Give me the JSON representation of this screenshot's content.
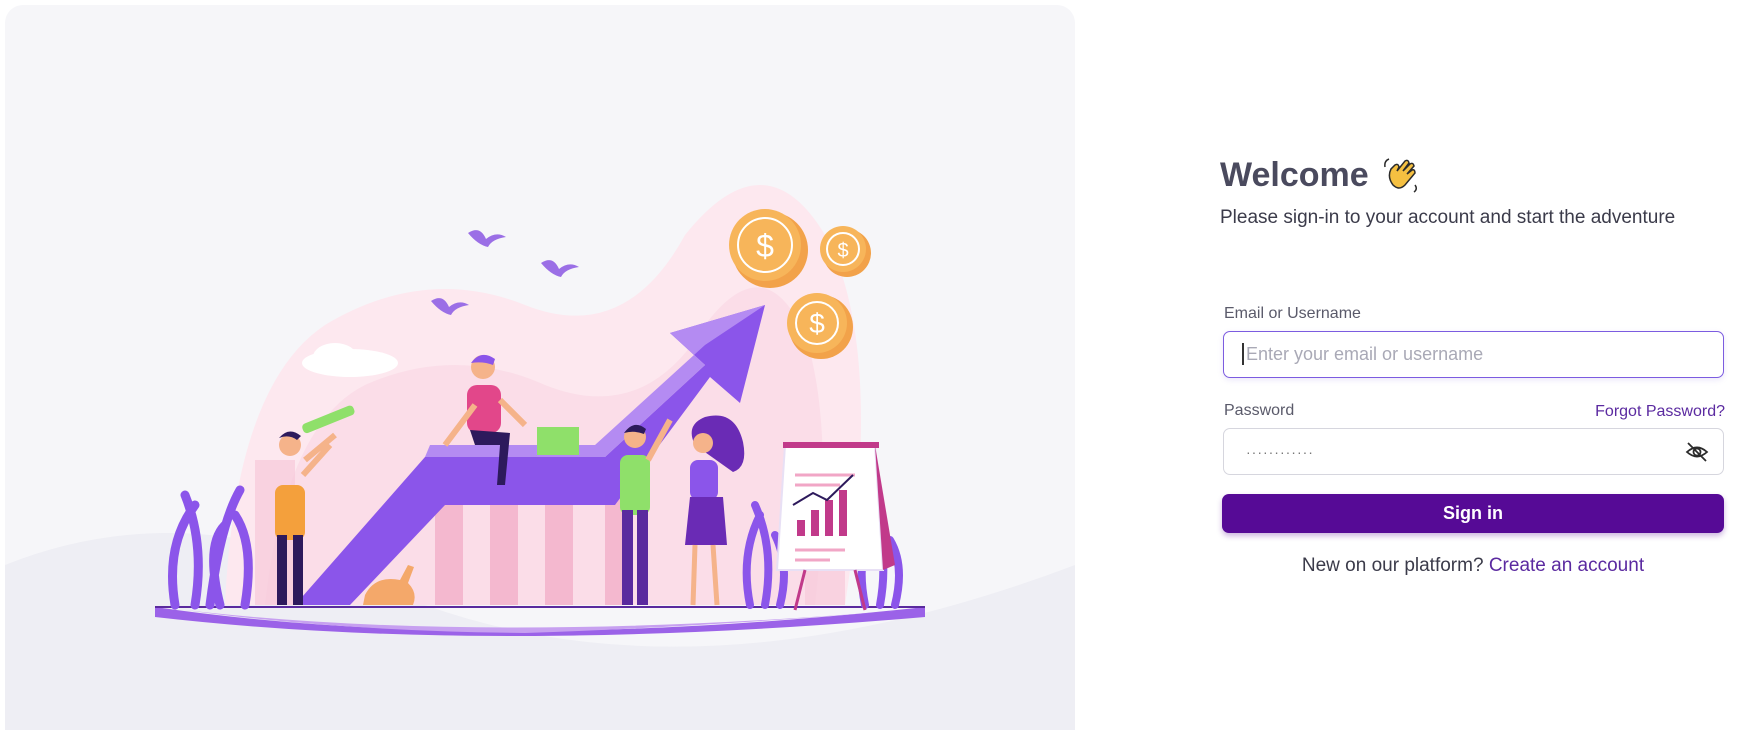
{
  "welcome": {
    "title": "Welcome",
    "icon": "waving-hand-icon"
  },
  "subtitle": "Please sign-in to your account and start the adventure",
  "form": {
    "email_label": "Email or Username",
    "email_placeholder": "Enter your email or username",
    "email_value": "",
    "password_label": "Password",
    "password_value": "············",
    "forgot_label": "Forgot Password?",
    "password_toggle_icon": "eye-off-icon",
    "submit_label": "Sign in"
  },
  "signup": {
    "prompt": "New on our platform?",
    "link_label": "Create an account"
  },
  "colors": {
    "brand": "#560a96",
    "accent": "#7c5ce0",
    "panel_bg": "#f6f6f9"
  }
}
